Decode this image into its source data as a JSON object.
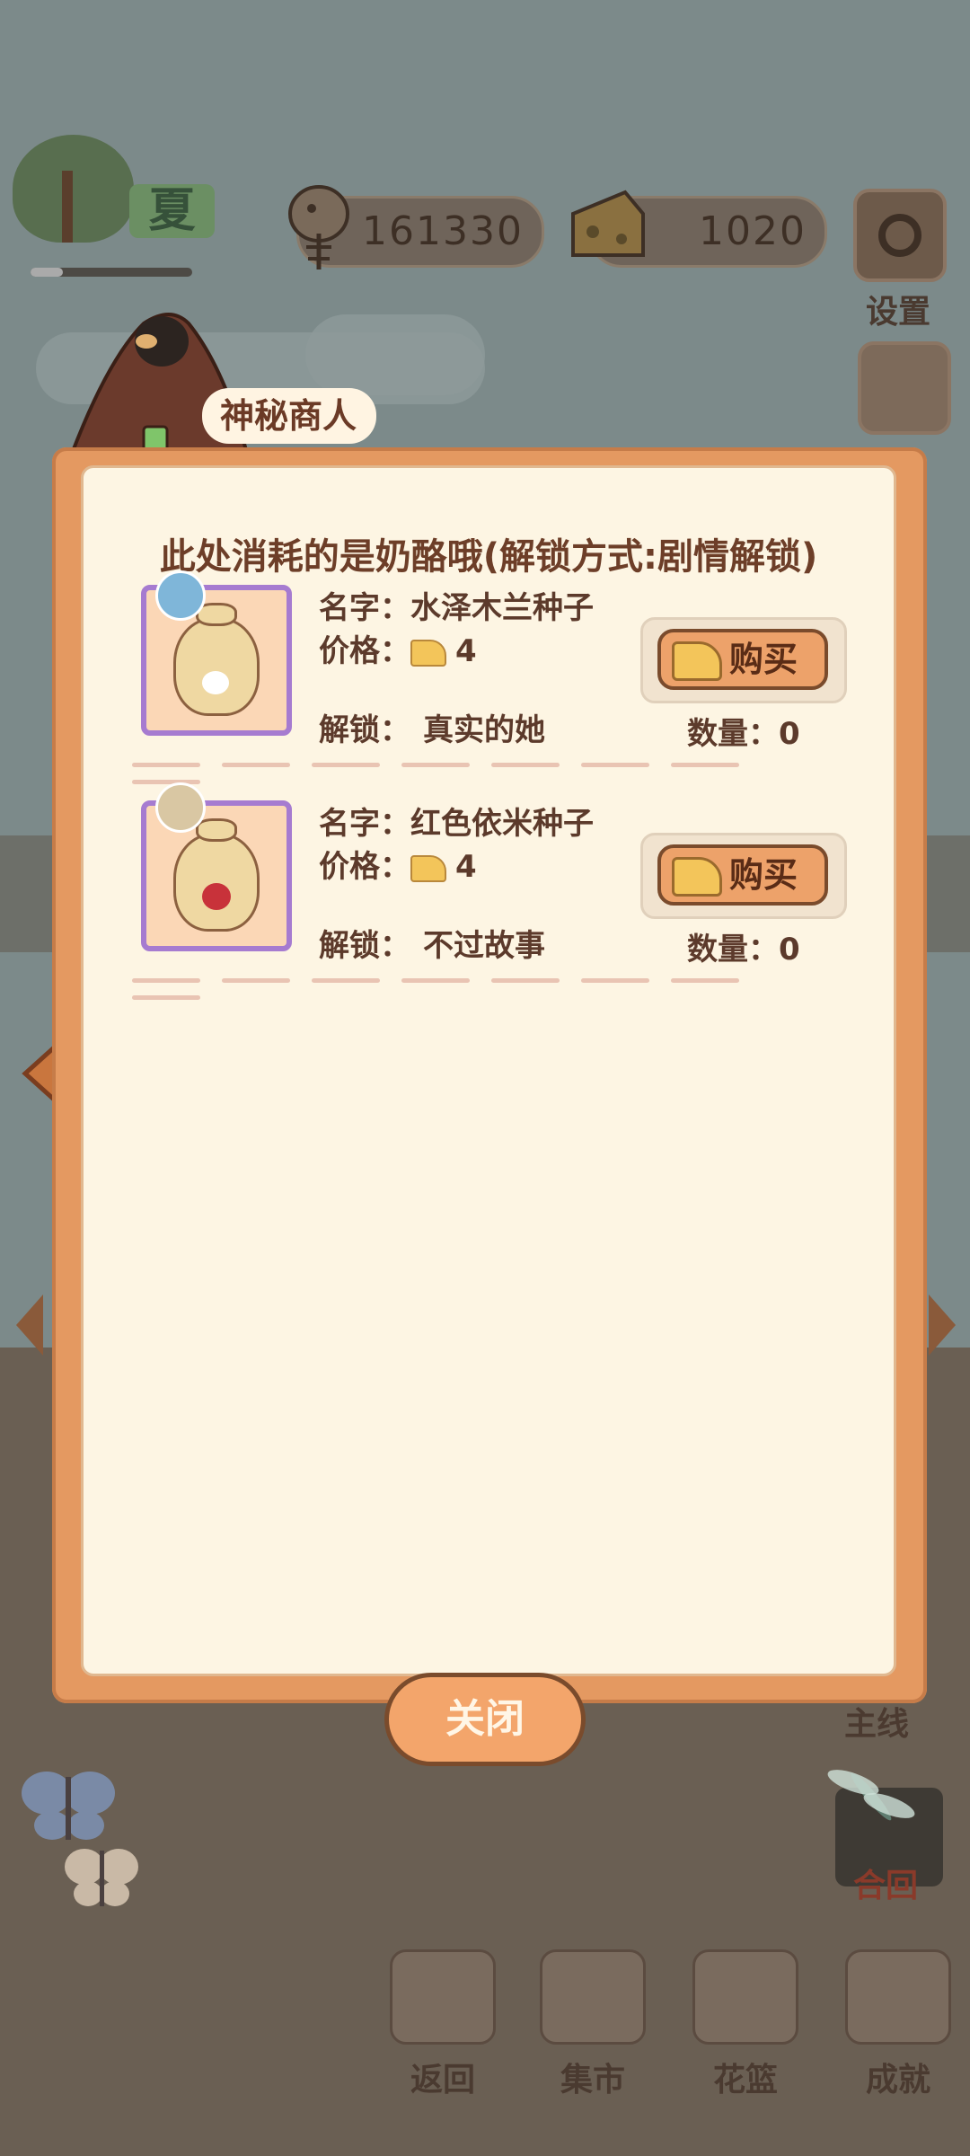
{
  "hud": {
    "season_label": "夏",
    "fish_currency": "161330",
    "cheese_currency": "1020",
    "settings_label": "设置"
  },
  "merchant": {
    "name": "神秘商人"
  },
  "dialog": {
    "headline": "此处消耗的是奶酪哦(解锁方式:剧情解锁)",
    "items": [
      {
        "name_label": "名字：",
        "name": "水泽木兰种子",
        "price_label": "价格：",
        "price": "4",
        "unlock_label": "解锁：",
        "unlock_value": "真实的她",
        "qty_label": "数量：",
        "qty": "0",
        "buy_label": "购买",
        "badge_color": "#7fb6d9",
        "flower_color": "#ffffff"
      },
      {
        "name_label": "名字：",
        "name": "红色依米种子",
        "price_label": "价格：",
        "price": "4",
        "unlock_label": "解锁：",
        "unlock_value": "不过故事",
        "qty_label": "数量：",
        "qty": "0",
        "buy_label": "购买",
        "badge_color": "#d9c7a3",
        "flower_color": "#c8323a"
      }
    ],
    "close_label": "关闭"
  },
  "side": {
    "mainline_label": "主线",
    "combine_label": "合回"
  },
  "bottom_nav": [
    {
      "label": "返回",
      "icon": "window-icon"
    },
    {
      "label": "集市",
      "icon": "market-stall-icon"
    },
    {
      "label": "花篮",
      "icon": "flower-basket-icon"
    },
    {
      "label": "成就",
      "icon": "trophy-icon"
    }
  ],
  "colors": {
    "panel_orange": "#e49961",
    "panel_cream": "#fdf5e3",
    "text_brown": "#5c3a2b"
  }
}
